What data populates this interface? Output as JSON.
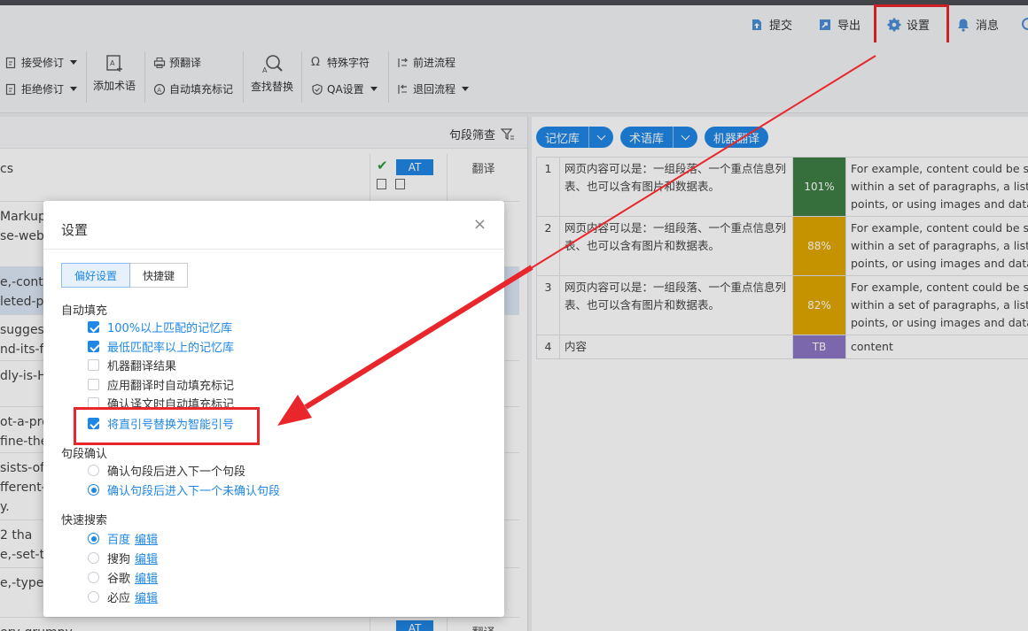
{
  "topnav": {
    "items": [
      {
        "label": "提交",
        "icon": "upload-icon"
      },
      {
        "label": "导出",
        "icon": "export-icon"
      },
      {
        "label": "设置",
        "icon": "gear-icon"
      },
      {
        "label": "消息",
        "icon": "bell-icon"
      }
    ]
  },
  "toolbar": {
    "accept_revision": "接受修订",
    "reject_revision": "拒绝修订",
    "add_term": "添加术语",
    "pre_translate": "预翻译",
    "autofill_marks": "自动填充标记",
    "find_replace": "查找替换",
    "special_chars": "特殊字符",
    "qa_settings": "QA设置",
    "forward_flow": "前进流程",
    "back_flow": "退回流程"
  },
  "left_pane": {
    "filter_label": "句段筛查",
    "rows": [
      {
        "text": "cs",
        "badge": "AT",
        "status": "翻译"
      },
      {
        "text": "Markup\nse-web-"
      },
      {
        "text": "e,-cont\nleted-po"
      },
      {
        "text": "sugges\nnd-its-fu"
      },
      {
        "text": "dly-is-HT"
      },
      {
        "text": "ot-a-pro\nfine-the"
      },
      {
        "text": "sists-of-\nfferent-p\ny."
      },
      {
        "text": "2 tha\ne,-set-th"
      },
      {
        "text": "e,-type"
      },
      {
        "text": "ery-grumpy",
        "badge": "AT",
        "status": "翻译"
      }
    ]
  },
  "right_pane": {
    "pills": [
      {
        "label": "记忆库",
        "dropdown": true
      },
      {
        "label": "术语库",
        "dropdown": true
      },
      {
        "label": "机器翻译",
        "dropdown": false
      }
    ],
    "matches": [
      {
        "num": "1",
        "source": "网页内容可以是：一组段落、一个重点信息列表、也可以含有图片和数据表。",
        "score": "101%",
        "color": "#3e7f45",
        "target": "For example, content could be stru\nwithin a set of paragraphs, a list of\npoints, or using images and data ta"
      },
      {
        "num": "2",
        "source": "网页内容可以是：一组段落、一个重点信息列表、也可以含有图片和数据表。",
        "score": "88%",
        "color": "#e2a800",
        "target": "For example, content could be stru\nwithin a set of paragraphs, a list of\npoints, or using images and data ta"
      },
      {
        "num": "3",
        "source": "网页内容可以是：一组段落、一个重点信息列表、也可以含有图片和数据表。",
        "score": "82%",
        "color": "#e2a800",
        "target": "For example, content could be stru\nwithin a set of paragraphs, a list of\npoints, or using images and data ta"
      },
      {
        "num": "4",
        "source": "内容",
        "score": "TB",
        "color": "#8d76c4",
        "target": "content"
      }
    ]
  },
  "modal": {
    "title": "设置",
    "close": "×",
    "tabs": [
      {
        "label": "偏好设置",
        "active": true
      },
      {
        "label": "快捷键",
        "active": false
      }
    ],
    "autofill": {
      "title": "自动填充",
      "options": [
        {
          "label": "100%以上匹配的记忆库",
          "checked": true
        },
        {
          "label": "最低匹配率以上的记忆库",
          "checked": true
        },
        {
          "label": "机器翻译结果",
          "checked": false
        },
        {
          "label": "应用翻译时自动填充标记",
          "checked": false
        },
        {
          "label": "确认译文时自动填充标记",
          "checked": false
        },
        {
          "label": "将直引号替换为智能引号",
          "checked": true
        }
      ]
    },
    "segment_confirm": {
      "title": "句段确认",
      "options": [
        {
          "label": "确认句段后进入下一个句段",
          "checked": false
        },
        {
          "label": "确认句段后进入下一个未确认句段",
          "checked": true
        }
      ]
    },
    "quick_search": {
      "title": "快速搜索",
      "edit_label": "编辑",
      "options": [
        {
          "label": "百度",
          "checked": true
        },
        {
          "label": "搜狗",
          "checked": false
        },
        {
          "label": "谷歌",
          "checked": false
        },
        {
          "label": "必应",
          "checked": false
        }
      ]
    }
  },
  "colors": {
    "accent": "#1f87e5",
    "annotation": "#e8262c"
  }
}
